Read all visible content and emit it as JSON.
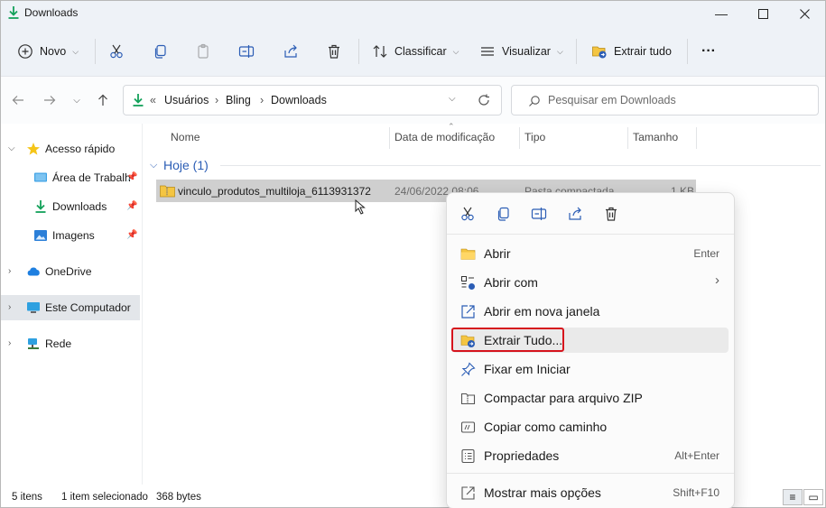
{
  "window": {
    "title": "Downloads"
  },
  "colors": {
    "accent": "#2b5db5",
    "highlight_box": "#d6141d",
    "download_green": "#13a15a",
    "folder_yellow": "#f4c542"
  },
  "toolbar": {
    "novo_label": "Novo",
    "classificar_label": "Classificar",
    "visualizar_label": "Visualizar",
    "extrair_label": "Extrair tudo",
    "more_label": "···"
  },
  "address": {
    "prefix": "«",
    "crumbs": [
      "Usuários",
      "Bling",
      "Downloads"
    ],
    "separator": "›"
  },
  "search": {
    "placeholder": "Pesquisar em Downloads"
  },
  "sidebar": {
    "items": [
      {
        "label": "Acesso rápido",
        "icon": "star-icon"
      },
      {
        "label": "Área de Trabalh",
        "icon": "desktop-icon"
      },
      {
        "label": "Downloads",
        "icon": "download-icon"
      },
      {
        "label": "Imagens",
        "icon": "image-icon"
      },
      {
        "label": "OneDrive",
        "icon": "cloud-icon"
      },
      {
        "label": "Este Computador",
        "icon": "computer-icon"
      },
      {
        "label": "Rede",
        "icon": "network-icon"
      }
    ]
  },
  "columns": {
    "name": "Nome",
    "date": "Data de modificação",
    "type": "Tipo",
    "size": "Tamanho"
  },
  "group": {
    "title": "Hoje (1)"
  },
  "file": {
    "name": "vinculo_produtos_multiloja_6113931372",
    "date": "24/06/2022 08:06",
    "type": "Pasta compactada",
    "size": "1 KB"
  },
  "context_menu": {
    "items": [
      {
        "label": "Abrir",
        "shortcut": "Enter",
        "icon": "folder-icon"
      },
      {
        "label": "Abrir com",
        "shortcut": "›",
        "icon": "open-with-icon"
      },
      {
        "label": "Abrir em nova janela",
        "shortcut": "",
        "icon": "new-window-icon"
      },
      {
        "label": "Extrair Tudo...",
        "shortcut": "",
        "icon": "extract-icon"
      },
      {
        "label": "Fixar em Iniciar",
        "shortcut": "",
        "icon": "pin-icon"
      },
      {
        "label": "Compactar para arquivo ZIP",
        "shortcut": "",
        "icon": "zip-icon"
      },
      {
        "label": "Copiar como caminho",
        "shortcut": "",
        "icon": "copy-path-icon"
      },
      {
        "label": "Propriedades",
        "shortcut": "Alt+Enter",
        "icon": "properties-icon"
      },
      {
        "label": "Mostrar mais opções",
        "shortcut": "Shift+F10",
        "icon": "more-options-icon"
      }
    ]
  },
  "status": {
    "count": "5 itens",
    "selected": "1 item selecionado",
    "size": "368 bytes"
  }
}
